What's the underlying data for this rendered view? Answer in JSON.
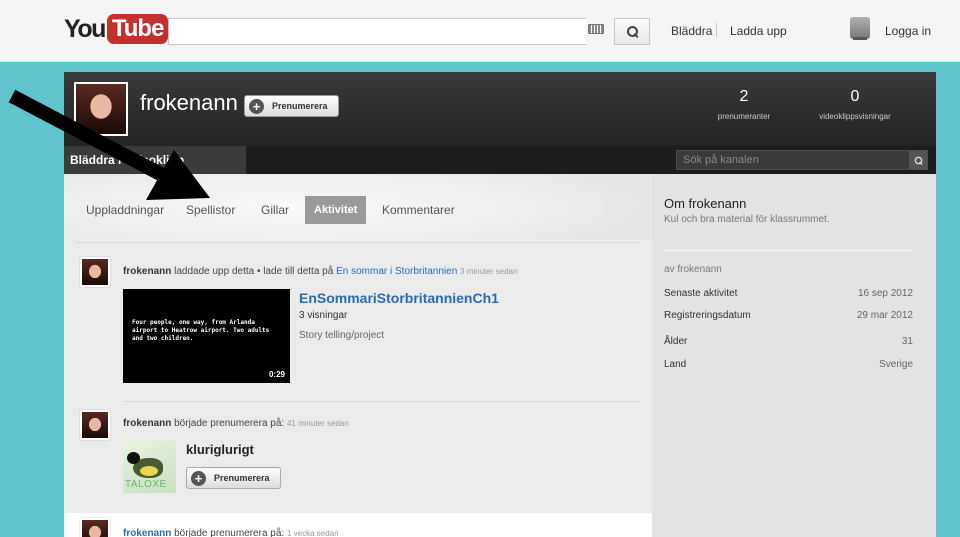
{
  "masthead": {
    "logo_you": "You",
    "logo_tube": "Tube",
    "search_value": "",
    "browse_label": "Bläddra",
    "upload_label": "Ladda upp",
    "signin_label": "Logga in"
  },
  "channel": {
    "name": "frokenann",
    "subscribe_label": "Prenumerera",
    "stats": [
      {
        "value": "2",
        "label": "prenumeranter"
      },
      {
        "value": "0",
        "label": "videoklippsvisningar"
      }
    ],
    "tab_videos": "Bläddra i videoklipp",
    "search_placeholder": "Sök på kanalen"
  },
  "feed": {
    "tabs": [
      {
        "label": "Uppladdningar"
      },
      {
        "label": "Spellistor"
      },
      {
        "label": "Gillar"
      },
      {
        "label": "Aktivitet",
        "active": true
      },
      {
        "label": "Kommentarer"
      }
    ],
    "activities": [
      {
        "user": "frokenann",
        "text": " laddade upp detta • lade till detta på ",
        "playlist": "En sommar i Storbritannien",
        "time": "3 minuter sedan",
        "video": {
          "title": "EnSommariStorbritannienCh1",
          "views": "3 visningar",
          "description": "Story telling/project",
          "thumb_text": "Four people, one way, from Arlanda airport to Heatrow airport. Two adults and two children.",
          "duration": "0:29"
        }
      },
      {
        "user": "frokenann",
        "text": " började prenumerera på:",
        "time": "41 minuter sedan",
        "channel": {
          "name": "kluriglurigt",
          "thumb_text": "TALOXE",
          "subscribe_label": "Prenumerera"
        }
      },
      {
        "user": "frokenann",
        "text": " började prenumerera på:",
        "time": "1 vecka sedan"
      }
    ]
  },
  "sidebar": {
    "about_title": "Om frokenann",
    "about_desc": "Kul och bra material för klassrummet.",
    "by_line": "av frokenann",
    "rows": [
      {
        "label": "Senaste aktivitet",
        "value": "16 sep 2012"
      },
      {
        "label": "Registreringsdatum",
        "value": "29 mar 2012"
      },
      {
        "label": "Ålder",
        "value": "31"
      },
      {
        "label": "Land",
        "value": "Sverige"
      }
    ]
  }
}
